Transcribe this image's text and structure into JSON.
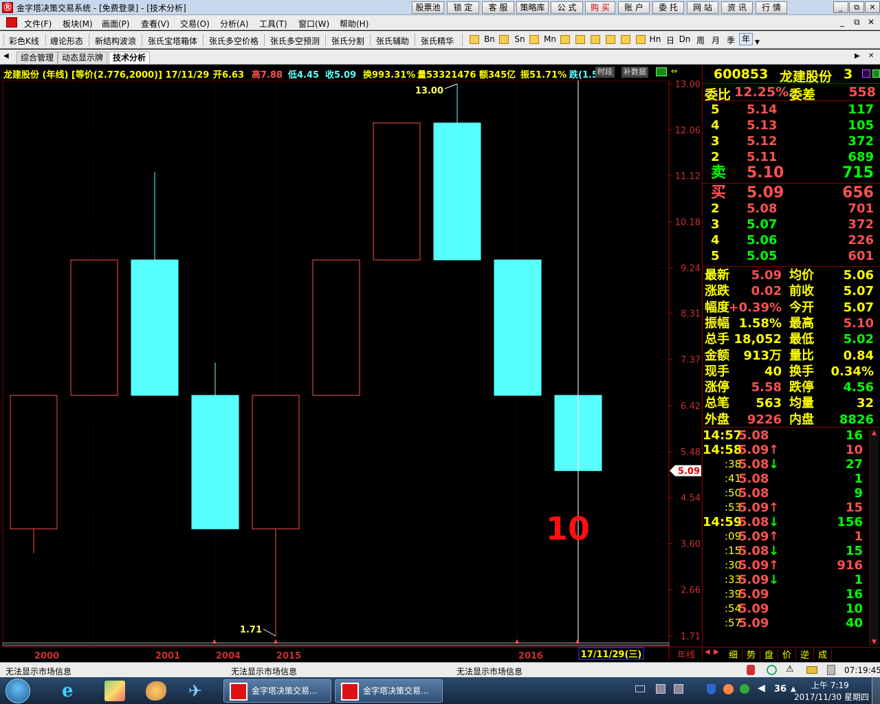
{
  "window": {
    "title": "金字塔决策交易系统 - [免费登录] - [技术分析]",
    "app_icon": "Ⓡ",
    "top_buttons": [
      "股票池",
      "锁 定",
      "客 服",
      "策略库",
      "公 式",
      "购 买",
      "账 户",
      "委 托",
      "网 站",
      "资 讯",
      "行 情"
    ],
    "controls": [
      "_",
      "⧉",
      "✕"
    ]
  },
  "menu": {
    "items": [
      "文件(F)",
      "板块(M)",
      "画面(P)",
      "查看(V)",
      "交易(O)",
      "分析(A)",
      "工具(T)",
      "窗口(W)",
      "帮助(H)"
    ],
    "mdi_controls": [
      "_",
      "⧉",
      "✕"
    ]
  },
  "toolbar": {
    "items": [
      "彩色K线",
      "缠论形态",
      "新结构波浪",
      "张氏宝塔箱体",
      "张氏多空价格",
      "张氏多空预测",
      "张氏分割",
      "张氏辅助",
      "张氏精华"
    ],
    "periods": [
      "Bn",
      "Sn",
      "Mn",
      "Hn",
      "日",
      "Dn",
      "周",
      "月",
      "季",
      "年"
    ]
  },
  "tabs": [
    "综合管理",
    "动态显示牌",
    "技术分析"
  ],
  "infobar": {
    "name": "龙建股份 (年线) [等价(2.776,2000)] 17/11/29",
    "open": "开6.63",
    "high": "高7.88",
    "low": "低4.45",
    "close": "收5.09",
    "turnover": "换993.31%",
    "volume": "量53321476",
    "amount": "额345亿",
    "amplitude": "振51.71%",
    "change": "跌(1.5",
    "btn_time": "时段",
    "btn_fill": "补数据"
  },
  "chart_data": {
    "type": "candlestick",
    "ylim": [
      1.71,
      13.0
    ],
    "yticks": [
      "13.00",
      "12.06",
      "11.12",
      "10.18",
      "9.24",
      "8.31",
      "7.37",
      "6.42",
      "5.48",
      "4.54",
      "3.60",
      "2.66",
      "1.71"
    ],
    "candles": [
      {
        "open": 6.63,
        "close": 3.9,
        "high": 6.63,
        "low": 3.4,
        "color": "red"
      },
      {
        "open": 6.63,
        "close": 9.4,
        "high": 9.4,
        "low": 6.63,
        "color": "red"
      },
      {
        "open": 9.4,
        "close": 6.63,
        "high": 11.2,
        "low": 6.63,
        "color": "cyan"
      },
      {
        "open": 6.63,
        "close": 3.9,
        "high": 7.3,
        "low": 3.9,
        "color": "cyan"
      },
      {
        "open": 3.9,
        "close": 6.63,
        "high": 6.63,
        "low": 1.71,
        "color": "red"
      },
      {
        "open": 6.63,
        "close": 9.4,
        "high": 9.4,
        "low": 6.63,
        "color": "red"
      },
      {
        "open": 9.4,
        "close": 12.2,
        "high": 12.2,
        "low": 9.4,
        "color": "red"
      },
      {
        "open": 12.2,
        "close": 9.4,
        "high": 13.0,
        "low": 9.4,
        "color": "cyan"
      },
      {
        "open": 9.4,
        "close": 6.63,
        "high": 9.4,
        "low": 6.63,
        "color": "cyan"
      },
      {
        "open": 6.63,
        "close": 5.09,
        "high": 7.88,
        "low": 4.45,
        "color": "cyan"
      }
    ],
    "high_label": "13.00",
    "low_label": "1.71",
    "current_price": "5.09",
    "overlay_number": "10",
    "x_labels": [
      "2000",
      "2001",
      "2004",
      "2015",
      "2016"
    ],
    "cursor_date": "17/11/29(三)",
    "period_label": "年线"
  },
  "quote": {
    "code": "600853",
    "name": "龙建股份",
    "num": "3",
    "weibi_label": "委比",
    "weibi": "12.25%",
    "weicha_label": "委差",
    "weicha": "558",
    "sells": [
      {
        "lvl": "5",
        "price": "5.14",
        "vol": "117"
      },
      {
        "lvl": "4",
        "price": "5.13",
        "vol": "105"
      },
      {
        "lvl": "3",
        "price": "5.12",
        "vol": "372"
      },
      {
        "lvl": "2",
        "price": "5.11",
        "vol": "689"
      },
      {
        "lvl": "卖",
        "price": "5.10",
        "vol": "715"
      }
    ],
    "buys": [
      {
        "lvl": "买",
        "price": "5.09",
        "vol": "656"
      },
      {
        "lvl": "2",
        "price": "5.08",
        "vol": "701"
      },
      {
        "lvl": "3",
        "price": "5.07",
        "vol": "372"
      },
      {
        "lvl": "4",
        "price": "5.06",
        "vol": "226"
      },
      {
        "lvl": "5",
        "price": "5.05",
        "vol": "601"
      }
    ],
    "stats": [
      {
        "l1": "最新",
        "v1": "5.09",
        "c1": "#ff5050",
        "l2": "均价",
        "v2": "5.06",
        "c2": "#ffff00"
      },
      {
        "l1": "涨跌",
        "v1": "0.02",
        "c1": "#ff5050",
        "l2": "前收",
        "v2": "5.07",
        "c2": "#ffff00"
      },
      {
        "l1": "幅度",
        "v1": "+0.39%",
        "c1": "#ff5050",
        "l2": "今开",
        "v2": "5.07",
        "c2": "#ffff00"
      },
      {
        "l1": "振幅",
        "v1": "1.58%",
        "c1": "#ffff00",
        "l2": "最高",
        "v2": "5.10",
        "c2": "#ff5050"
      },
      {
        "l1": "总手",
        "v1": "18,052",
        "c1": "#ffff00",
        "l2": "最低",
        "v2": "5.02",
        "c2": "#00ff00"
      },
      {
        "l1": "金额",
        "v1": "913万",
        "c1": "#ffff00",
        "l2": "量比",
        "v2": "0.84",
        "c2": "#ffff00"
      },
      {
        "l1": "现手",
        "v1": "40",
        "c1": "#ffff00",
        "l2": "换手",
        "v2": "0.34%",
        "c2": "#ffff00"
      },
      {
        "l1": "涨停",
        "v1": "5.58",
        "c1": "#ff5050",
        "l2": "跌停",
        "v2": "4.56",
        "c2": "#00ff00"
      },
      {
        "l1": "总笔",
        "v1": "563",
        "c1": "#ffff00",
        "l2": "均量",
        "v2": "32",
        "c2": "#ffff00"
      },
      {
        "l1": "外盘",
        "v1": "9226",
        "c1": "#ff5050",
        "l2": "内盘",
        "v2": "8826",
        "c2": "#00ff00"
      }
    ],
    "ticks": [
      {
        "t": "14:57",
        "p": "5.08",
        "a": "",
        "v": "16",
        "pc": "#ff5050",
        "vc": "#00ff00"
      },
      {
        "t": "14:58",
        "p": "5.09",
        "a": "↑",
        "v": "10",
        "pc": "#ff5050",
        "vc": "#ff5050"
      },
      {
        "t": ":38",
        "p": "5.08",
        "a": "↓",
        "v": "27",
        "pc": "#ff5050",
        "vc": "#00ff00"
      },
      {
        "t": ":41",
        "p": "5.08",
        "a": "",
        "v": "1",
        "pc": "#ff5050",
        "vc": "#00ff00"
      },
      {
        "t": ":50",
        "p": "5.08",
        "a": "",
        "v": "9",
        "pc": "#ff5050",
        "vc": "#00ff00"
      },
      {
        "t": ":53",
        "p": "5.09",
        "a": "↑",
        "v": "15",
        "pc": "#ff5050",
        "vc": "#ff5050"
      },
      {
        "t": "14:59",
        "p": "5.08",
        "a": "↓",
        "v": "156",
        "pc": "#ff5050",
        "vc": "#00ff00"
      },
      {
        "t": ":09",
        "p": "5.09",
        "a": "↑",
        "v": "1",
        "pc": "#ff5050",
        "vc": "#ff5050"
      },
      {
        "t": ":15",
        "p": "5.08",
        "a": "↓",
        "v": "15",
        "pc": "#ff5050",
        "vc": "#00ff00"
      },
      {
        "t": ":30",
        "p": "5.09",
        "a": "↑",
        "v": "916",
        "pc": "#ff5050",
        "vc": "#ff5050"
      },
      {
        "t": ":33",
        "p": "5.09",
        "a": "↓",
        "v": "1",
        "pc": "#ff5050",
        "vc": "#00ff00"
      },
      {
        "t": ":39",
        "p": "5.09",
        "a": "",
        "v": "16",
        "pc": "#ff5050",
        "vc": "#00ff00"
      },
      {
        "t": ":54",
        "p": "5.09",
        "a": "",
        "v": "10",
        "pc": "#ff5050",
        "vc": "#00ff00"
      },
      {
        "t": ":57",
        "p": "5.09",
        "a": "",
        "v": "40",
        "pc": "#ff5050",
        "vc": "#00ff00"
      }
    ],
    "bottom_tabs": [
      "细",
      "势",
      "盘",
      "价",
      "逆",
      "成"
    ]
  },
  "status": {
    "msg1": "无法显示市场信息",
    "msg2": "无法显示市场信息",
    "msg3": "无法显示市场信息",
    "time": "07:19:45"
  },
  "taskbar": {
    "task1": "金字塔决策交易...",
    "task2": "金字塔决策交易...",
    "tray_num": "36",
    "clock_time": "上午 7:19",
    "clock_date": "2017/11/30 星期四"
  }
}
